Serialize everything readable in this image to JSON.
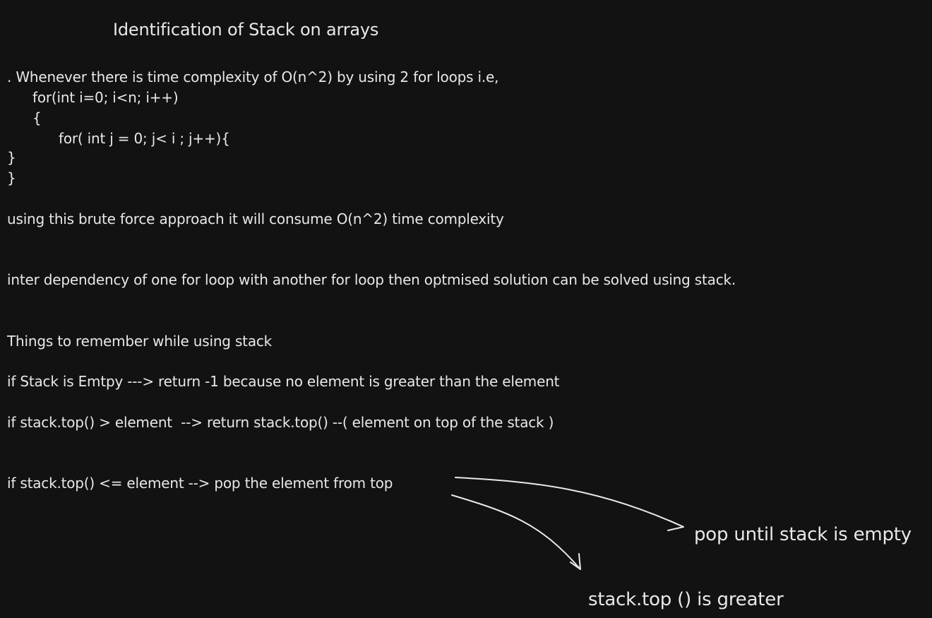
{
  "canvas": {
    "background": "#121212",
    "stroke_color": "#e8e8e8"
  },
  "title": "Identification of Stack on arrays",
  "intro_line": ". Whenever there is time complexity of O(n^2) by using 2 for loops i.e,",
  "code": {
    "outer_loop": "for(int i=0; i<n; i++)",
    "open_brace": "{",
    "inner_loop": "for( int j = 0; j< i ; j++){",
    "close_brace_1": "}",
    "close_brace_2": "}"
  },
  "brute_force_note": "using this brute force approach it will consume O(n^2) time complexity",
  "dependency_note": "inter dependency of one for loop with another for loop then optmised solution can be solved using stack.",
  "things_heading": "Things to remember while using stack",
  "rules": [
    "if Stack is Emtpy ---> return -1 because no element is greater than the element",
    "if stack.top() > element  --> return stack.top() --( element on top of the stack )",
    "if stack.top() <= element --> pop the element from top"
  ],
  "arrow_targets": {
    "pop_until_empty": "pop until stack is empty",
    "top_is_greater": "stack.top () is greater"
  }
}
